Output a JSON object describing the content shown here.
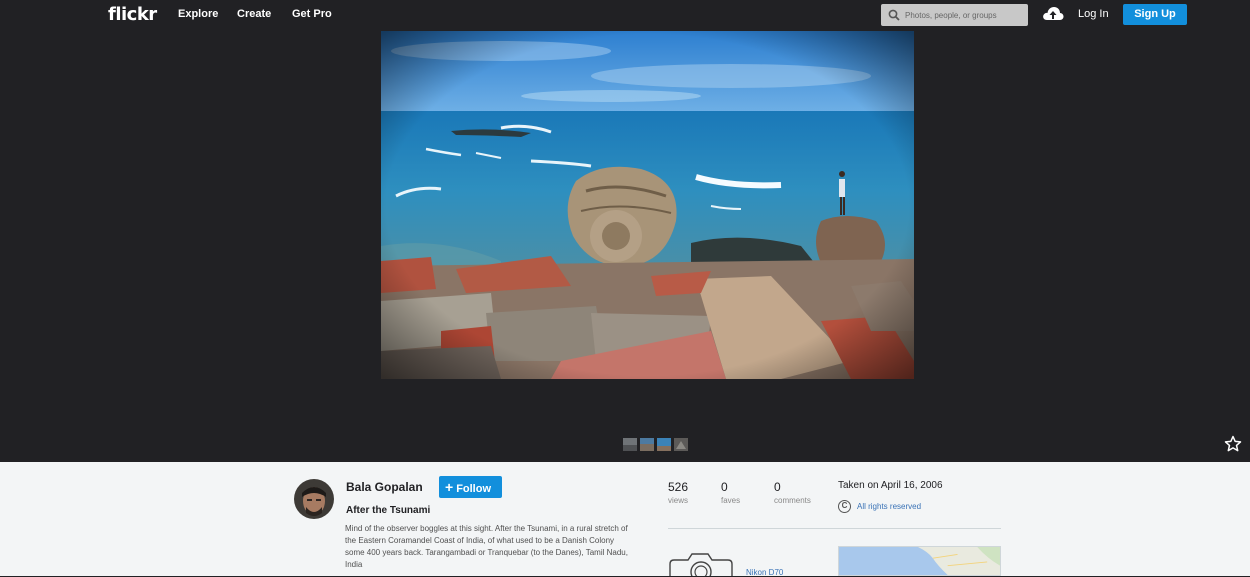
{
  "header": {
    "logo": "flickr",
    "nav": [
      "Explore",
      "Create",
      "Get Pro"
    ],
    "search_placeholder": "Photos, people, or groups",
    "login_label": "Log In",
    "signup_label": "Sign Up"
  },
  "photo_meta": {
    "owner": "Bala Gopalan",
    "follow_label": "Follow",
    "title": "After the Tsunami",
    "description": "Mind of the observer boggles at this sight. After the Tsunami, in a rural stretch of the Eastern Coramandel Coast of India, of what used to be a Danish Colony some 400 years back. Tarangambadi or Tranquebar (to the Danes), Tamil Nadu, India"
  },
  "stats": {
    "views": {
      "value": "526",
      "label": "views"
    },
    "faves": {
      "value": "0",
      "label": "faves"
    },
    "comments": {
      "value": "0",
      "label": "comments"
    }
  },
  "taken": "Taken on April 16, 2006",
  "rights": "All rights reserved",
  "camera": "Nikon D70",
  "colors": {
    "accent": "#128fdc",
    "link": "#3a73b6",
    "dark_bg": "#212124"
  }
}
